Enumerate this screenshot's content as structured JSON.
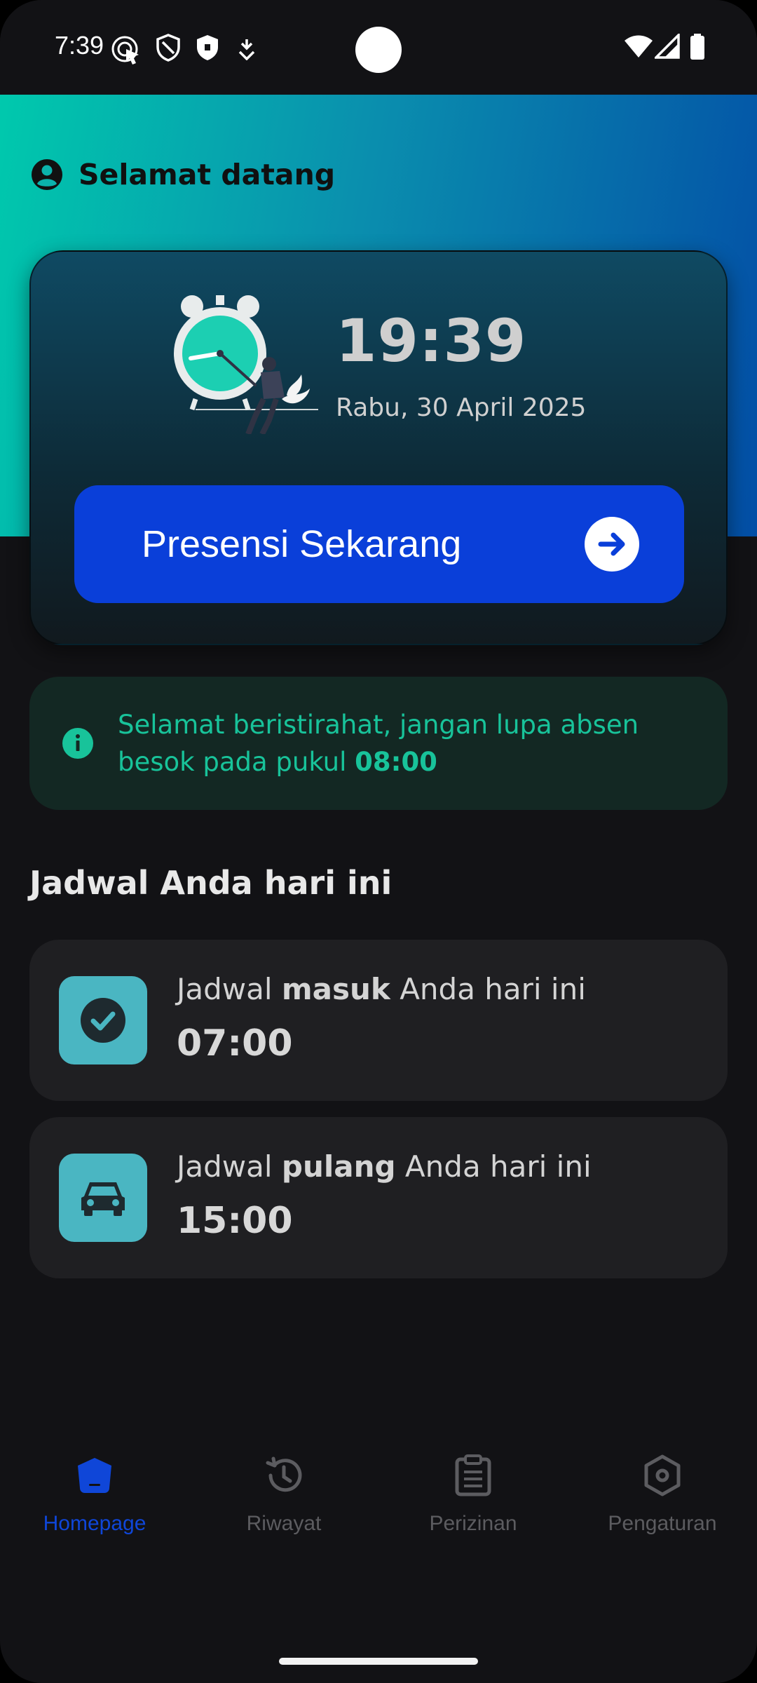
{
  "status_bar": {
    "time": "7:39",
    "left_icons": [
      "touch-indicator-icon",
      "shield-outline-icon",
      "shield-filled-icon",
      "download-icon"
    ],
    "right_icons": [
      "wifi-icon",
      "cell-signal-icon",
      "battery-icon"
    ]
  },
  "header": {
    "welcome": "Selamat datang",
    "welcome_icon": "account-circle-icon"
  },
  "time_card": {
    "time": "19:39",
    "date": "Rabu, 30 April 2025",
    "illustration": "alarm-clock-person-illustration",
    "button_label": "Presensi Sekarang",
    "button_icon": "arrow-right-circle-icon",
    "button_color": "#0a3fd9"
  },
  "info": {
    "icon": "info-icon",
    "text": "Selamat beristirahat, jangan lupa absen besok pada pukul ",
    "time": "08:00",
    "color": "#18c39a"
  },
  "schedule": {
    "title": "Jadwal Anda hari ini",
    "items": [
      {
        "prefix": "Jadwal ",
        "keyword": "masuk",
        "suffix": " Anda hari ini",
        "time": "07:00",
        "icon": "check-circle-icon"
      },
      {
        "prefix": "Jadwal ",
        "keyword": "pulang",
        "suffix": " Anda hari ini",
        "time": "15:00",
        "icon": "car-icon"
      }
    ]
  },
  "bottom_nav": {
    "items": [
      {
        "label": "Homepage",
        "icon": "home-pentagon-icon",
        "active": true
      },
      {
        "label": "Riwayat",
        "icon": "history-icon",
        "active": false
      },
      {
        "label": "Perizinan",
        "icon": "clipboard-icon",
        "active": false
      },
      {
        "label": "Pengaturan",
        "icon": "settings-hexagon-icon",
        "active": false
      }
    ],
    "active_color": "#0f46d8"
  }
}
